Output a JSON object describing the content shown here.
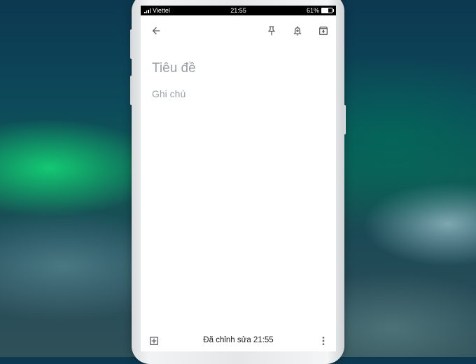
{
  "status_bar": {
    "carrier": "Viettel",
    "time": "21:55",
    "battery": "61%",
    "battery_level": 0.61
  },
  "toolbar": {
    "back_icon": "arrow-left-icon",
    "pin_icon": "pin-icon",
    "reminder_icon": "bell-plus-icon",
    "archive_icon": "archive-icon"
  },
  "note": {
    "title_placeholder": "Tiêu đề",
    "body_placeholder": "Ghi chú"
  },
  "bottom_bar": {
    "add_icon": "add-box-icon",
    "edited_text": "Đã chỉnh sửa 21:55",
    "more_icon": "more-vert-icon"
  },
  "colors": {
    "icon": "#5f6368",
    "placeholder": "#9aa0a6",
    "text": "#202124"
  }
}
